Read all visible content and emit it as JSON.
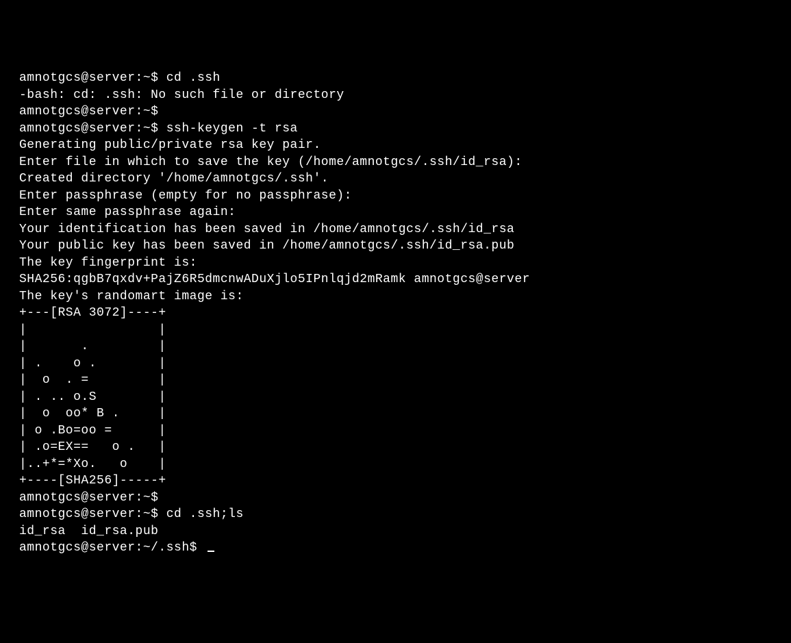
{
  "lines": [
    "amnotgcs@server:~$ cd .ssh",
    "-bash: cd: .ssh: No such file or directory",
    "amnotgcs@server:~$",
    "amnotgcs@server:~$ ssh-keygen -t rsa",
    "Generating public/private rsa key pair.",
    "Enter file in which to save the key (/home/amnotgcs/.ssh/id_rsa):",
    "Created directory '/home/amnotgcs/.ssh'.",
    "Enter passphrase (empty for no passphrase):",
    "Enter same passphrase again:",
    "Your identification has been saved in /home/amnotgcs/.ssh/id_rsa",
    "Your public key has been saved in /home/amnotgcs/.ssh/id_rsa.pub",
    "The key fingerprint is:",
    "SHA256:qgbB7qxdv+PajZ6R5dmcnwADuXjlo5IPnlqjd2mRamk amnotgcs@server",
    "The key's randomart image is:",
    "+---[RSA 3072]----+",
    "|                 |",
    "|       .         |",
    "| .    o .        |",
    "|  o  . =         |",
    "| . .. o.S        |",
    "|  o  oo* B .     |",
    "| o .Bo=oo =      |",
    "| .o=EX==   o .   |",
    "|..+*=*Xo.   o    |",
    "+----[SHA256]-----+",
    "amnotgcs@server:~$",
    "amnotgcs@server:~$ cd .ssh;ls",
    "id_rsa  id_rsa.pub",
    "amnotgcs@server:~/.ssh$ "
  ]
}
